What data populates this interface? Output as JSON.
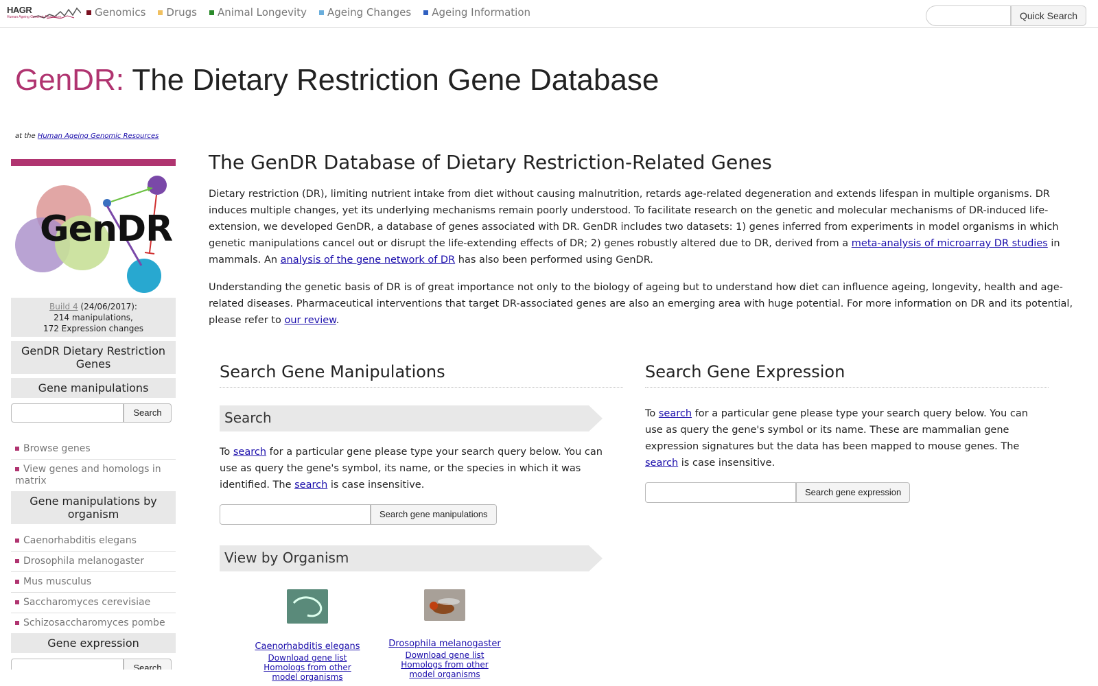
{
  "topbar": {
    "logo_text": "HAGR",
    "logo_sub": "Human Ageing Genomic Resources",
    "nav": [
      {
        "label": "Genomics",
        "color": "#7a1020"
      },
      {
        "label": "Drugs",
        "color": "#f0c060"
      },
      {
        "label": "Animal Longevity",
        "color": "#2a8a2a"
      },
      {
        "label": "Ageing Changes",
        "color": "#6aaedc"
      },
      {
        "label": "Ageing Information",
        "color": "#3060c0"
      }
    ],
    "quick_search_label": "Quick Search",
    "quick_search_value": ""
  },
  "banner": {
    "brand": "GenDR:",
    "title": " The Dietary Restriction Gene Database",
    "at_prefix": "at the ",
    "at_link": "Human Ageing Genomic Resources"
  },
  "sidebar": {
    "logo_text": "GenDR",
    "build_link": "Build 4",
    "build_date": " (24/06/2017):",
    "build_manip": "214 manipulations,",
    "build_expr": "172 Expression changes",
    "head_main": "GenDR Dietary Restriction Genes",
    "head_manip": "Gene manipulations",
    "search_btn": "Search",
    "links_manip": [
      "Browse genes",
      "View genes and homologs in matrix"
    ],
    "head_org": "Gene manipulations by organism",
    "links_org": [
      "Caenorhabditis elegans",
      "Drosophila melanogaster",
      "Mus musculus",
      "Saccharomyces cerevisiae",
      "Schizosaccharomyces pombe"
    ],
    "head_expr": "Gene expression",
    "expr_search_btn": "Search"
  },
  "main": {
    "title": "The GenDR Database of Dietary Restriction-Related Genes",
    "p1_a": "Dietary restriction (DR), limiting nutrient intake from diet without causing malnutrition, retards age-related degeneration and extends lifespan in multiple organisms. DR induces multiple changes, yet its underlying mechanisms remain poorly understood. To facilitate research on the genetic and molecular mechanisms of DR-induced life-extension, we developed GenDR, a database of genes associated with DR. GenDR includes two datasets: 1) genes inferred from experiments in model organisms in which genetic manipulations cancel out or disrupt the life-extending effects of DR; 2) genes robustly altered due to DR, derived from a ",
    "p1_link1": "meta-analysis of microarray DR studies",
    "p1_b": " in mammals. An ",
    "p1_link2": "analysis of the gene network of DR",
    "p1_c": " has also been performed using GenDR.",
    "p2_a": "Understanding the genetic basis of DR is of great importance not only to the biology of ageing but to understand how diet can influence ageing, longevity, health and age-related diseases. Pharmaceutical interventions that target DR-associated genes are also an emerging area with huge potential. For more information on DR and its potential, please refer to ",
    "p2_link": "our review",
    "p2_b": "."
  },
  "manip": {
    "title": "Search Gene Manipulations",
    "section": "Search",
    "text_a": "To ",
    "link": "search",
    "text_b": " for a particular gene please type your search query below. You can use as query the gene's symbol, its name, or the species in which it was identified. The ",
    "link2": "search",
    "text_c": " is case insensitive.",
    "button": "Search gene manipulations",
    "org_section": "View by Organism",
    "orgs": [
      {
        "name": "Caenorhabditis elegans",
        "download": "Download gene list",
        "homologs": "Homologs from other model organisms"
      },
      {
        "name": "Drosophila melanogaster",
        "download": "Download gene list",
        "homologs": "Homologs from other model organisms"
      }
    ]
  },
  "expr": {
    "title": "Search Gene Expression",
    "text_a": "To ",
    "link": "search",
    "text_b": " for a particular gene please type your search query below. You can use as query the gene's symbol or its name. These are mammalian gene expression signatures but the data has been mapped to mouse genes. The ",
    "link2": "search",
    "text_c": " is case insensitive.",
    "button": "Search gene expression"
  }
}
